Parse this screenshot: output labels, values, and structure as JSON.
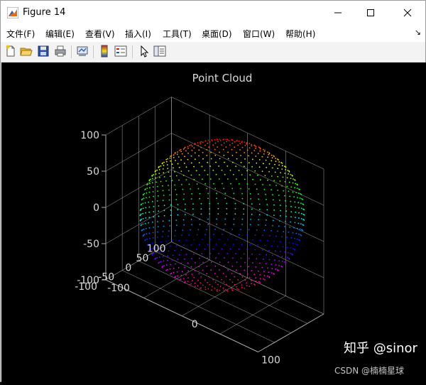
{
  "window": {
    "title": "Figure 14"
  },
  "menu": {
    "items": [
      "文件(F)",
      "编辑(E)",
      "查看(V)",
      "插入(I)",
      "工具(T)",
      "桌面(D)",
      "窗口(W)",
      "帮助(H)"
    ]
  },
  "toolbar": {
    "buttons": [
      "new-figure-icon",
      "open-file-icon",
      "save-icon",
      "print-icon",
      "link-plot-icon",
      "colorbar-icon",
      "legend-icon",
      "edit-pointer-icon",
      "property-inspector-icon"
    ]
  },
  "watermark": {
    "zhihu": "知乎 @sinor",
    "csdn": "CSDN @楠楠星球"
  },
  "chart_data": {
    "type": "scatter3d",
    "title": "Point Cloud",
    "xlabel": "",
    "ylabel": "",
    "zlabel": "",
    "x_ticks": [
      100,
      0,
      -100
    ],
    "y_ticks": [
      100,
      50,
      0,
      -50,
      -100
    ],
    "z_ticks": [
      100,
      50,
      0,
      -50,
      -100
    ],
    "xlim": [
      -100,
      100
    ],
    "ylim": [
      -100,
      100
    ],
    "zlim": [
      -100,
      100
    ],
    "shape": "sphere",
    "radius": 100,
    "colormap": "hsv",
    "colormap_axis": "z",
    "background": "#000000",
    "axis_color": "#a8a8a8",
    "grid": true
  }
}
